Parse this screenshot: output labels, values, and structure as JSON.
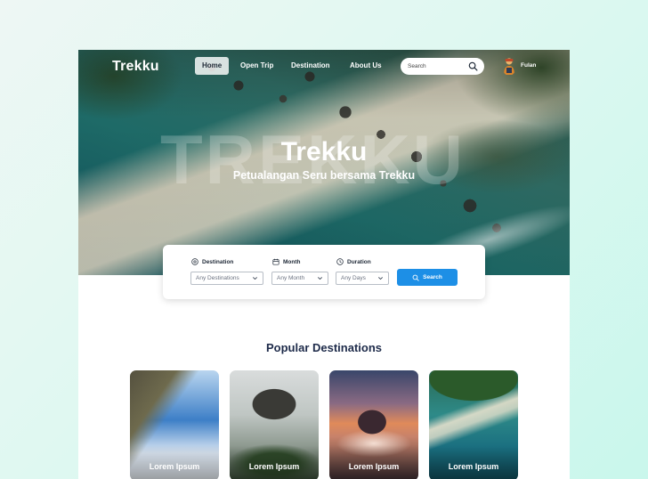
{
  "brand": {
    "logo": "Trekku"
  },
  "nav": {
    "items": [
      {
        "label": "Home",
        "active": true
      },
      {
        "label": "Open Trip",
        "active": false
      },
      {
        "label": "Destination",
        "active": false
      },
      {
        "label": "About Us",
        "active": false
      }
    ]
  },
  "search": {
    "placeholder": "Search",
    "icon": "search-icon"
  },
  "user": {
    "name": "Fulan",
    "avatar_icon": "avatar"
  },
  "hero": {
    "watermark": "TREKKU",
    "title": "Trekku",
    "subtitle": "Petualangan Seru bersama Trekku"
  },
  "search_panel": {
    "destination": {
      "label": "Destination",
      "value": "Any Destinations",
      "icon": "location-pin-icon"
    },
    "month": {
      "label": "Month",
      "value": "Any Month",
      "icon": "calendar-icon"
    },
    "duration": {
      "label": "Duration",
      "value": "Any Days",
      "icon": "clock-icon"
    },
    "button": {
      "label": "Search",
      "color": "#1d8fe6"
    }
  },
  "popular": {
    "title": "Popular Destinations",
    "cards": [
      {
        "label": "Lorem Ipsum"
      },
      {
        "label": "Lorem Ipsum"
      },
      {
        "label": "Lorem Ipsum"
      },
      {
        "label": "Lorem Ipsum"
      }
    ]
  },
  "colors": {
    "accent": "#1d8fe6",
    "heading": "#1e2b4a"
  }
}
